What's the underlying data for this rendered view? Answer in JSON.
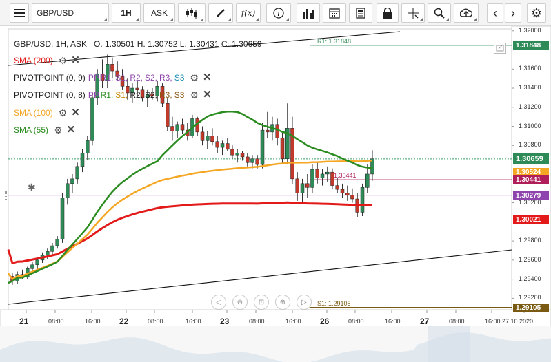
{
  "toolbar": {
    "symbol": "GBP/USD",
    "timeframe": "1H",
    "price_type": "ASK"
  },
  "legend": {
    "ohlc": "GBP/USD, 1H, ASK   O. 1.30501 H. 1.30752 L. 1.30431 C. 1.30659",
    "sma200": "SMA (200)",
    "pivot1_prefix": "PIVOTPOINT (0, 9)",
    "pivot2_prefix": "PIVOTPOINT (0, 8)",
    "pivot_parts": [
      "PP,",
      "R1,",
      "S1,",
      "R2,",
      "S2,",
      "R3,",
      "S3"
    ],
    "sma100": "SMA (100)",
    "sma55": "SMA (55)"
  },
  "colors": {
    "sma200": "#e31a1a",
    "sma100": "#f5a623",
    "sma55": "#2a8c1f",
    "up": "#2e8b57",
    "down": "#c0392b",
    "pivot": "#8e44ad"
  },
  "chart_data": {
    "type": "candlestick",
    "symbol": "GBP/USD",
    "timeframe": "1H",
    "ohlc": {
      "open": 1.30501,
      "high": 1.30752,
      "low": 1.30431,
      "close": 1.30659
    },
    "y_ticks": [
      "1.32000",
      "1.31600",
      "1.31400",
      "1.31200",
      "1.31000",
      "1.30800",
      "1.30200",
      "1.29800",
      "1.29600",
      "1.29400",
      "1.29200"
    ],
    "ylim": [
      1.2908,
      1.3202
    ],
    "x_ticks": [
      "21",
      "08:00",
      "16:00",
      "22",
      "08:00",
      "16:00",
      "23",
      "08:00",
      "16:00",
      "26",
      "08:00",
      "16:00",
      "27",
      "08:00",
      "16:00",
      "27.10.2020"
    ],
    "price_levels": [
      {
        "label": "1.31848",
        "name": "R1: 1.31848",
        "value": 1.31848,
        "color": "#2e8b57"
      },
      {
        "label": "1.30659",
        "name": "",
        "value": 1.30659,
        "color": "#2e8b57"
      },
      {
        "label": "1.30524",
        "name": "",
        "value": 1.30524,
        "color": "#f5a623"
      },
      {
        "label": "1.30441",
        "name": "1.30441",
        "value": 1.30441,
        "color": "#b01e5a"
      },
      {
        "label": "1.30279",
        "name": "",
        "value": 1.30279,
        "color": "#8e44ad"
      },
      {
        "label": "1.30021",
        "name": "",
        "value": 1.30021,
        "color": "#e31a1a"
      },
      {
        "label": "1.29105",
        "name": "S1: 1.29105",
        "value": 1.29105,
        "color": "#7a5a12"
      }
    ],
    "candles": [
      [
        1.2943,
        1.2946,
        1.2934,
        1.2938
      ],
      [
        1.2938,
        1.2948,
        1.2935,
        1.2945
      ],
      [
        1.2945,
        1.295,
        1.294,
        1.2942
      ],
      [
        1.2942,
        1.2953,
        1.294,
        1.2951
      ],
      [
        1.2951,
        1.2958,
        1.2947,
        1.2955
      ],
      [
        1.2955,
        1.2962,
        1.295,
        1.296
      ],
      [
        1.296,
        1.2968,
        1.2957,
        1.2965
      ],
      [
        1.2965,
        1.2972,
        1.2961,
        1.2969
      ],
      [
        1.2969,
        1.2978,
        1.2966,
        1.2975
      ],
      [
        1.2975,
        1.2985,
        1.2972,
        1.2982
      ],
      [
        1.2982,
        1.303,
        1.2978,
        1.3025
      ],
      [
        1.3025,
        1.3045,
        1.3018,
        1.304
      ],
      [
        1.304,
        1.305,
        1.303,
        1.3045
      ],
      [
        1.3045,
        1.3062,
        1.304,
        1.3058
      ],
      [
        1.3058,
        1.3076,
        1.3052,
        1.3072
      ],
      [
        1.3072,
        1.309,
        1.3065,
        1.3085
      ],
      [
        1.3085,
        1.3135,
        1.308,
        1.313
      ],
      [
        1.313,
        1.316,
        1.3122,
        1.3155
      ],
      [
        1.3155,
        1.317,
        1.314,
        1.3148
      ],
      [
        1.3148,
        1.3175,
        1.314,
        1.3165
      ],
      [
        1.3165,
        1.3172,
        1.315,
        1.3158
      ],
      [
        1.3158,
        1.3168,
        1.3148,
        1.3152
      ],
      [
        1.3152,
        1.316,
        1.3138,
        1.3142
      ],
      [
        1.3142,
        1.315,
        1.3128,
        1.3135
      ],
      [
        1.3135,
        1.3145,
        1.3125,
        1.314
      ],
      [
        1.314,
        1.3148,
        1.313,
        1.3138
      ],
      [
        1.3138,
        1.3142,
        1.3126,
        1.313
      ],
      [
        1.313,
        1.3138,
        1.312,
        1.3134
      ],
      [
        1.3134,
        1.314,
        1.3128,
        1.3132
      ],
      [
        1.3132,
        1.3148,
        1.3126,
        1.3142
      ],
      [
        1.3142,
        1.3145,
        1.312,
        1.3124
      ],
      [
        1.3124,
        1.313,
        1.3095,
        1.31
      ],
      [
        1.31,
        1.311,
        1.3085,
        1.3095
      ],
      [
        1.3095,
        1.3105,
        1.3088,
        1.3102
      ],
      [
        1.3102,
        1.3108,
        1.3092,
        1.3096
      ],
      [
        1.3096,
        1.3104,
        1.3085,
        1.309
      ],
      [
        1.309,
        1.3112,
        1.3088,
        1.3108
      ],
      [
        1.3108,
        1.311,
        1.309,
        1.3094
      ],
      [
        1.3094,
        1.31,
        1.308,
        1.3085
      ],
      [
        1.3085,
        1.3095,
        1.3076,
        1.309
      ],
      [
        1.309,
        1.3098,
        1.308,
        1.3084
      ],
      [
        1.3084,
        1.309,
        1.3072,
        1.3078
      ],
      [
        1.3078,
        1.3085,
        1.307,
        1.3082
      ],
      [
        1.3082,
        1.3088,
        1.3074,
        1.3076
      ],
      [
        1.3076,
        1.308,
        1.3066,
        1.307
      ],
      [
        1.307,
        1.3076,
        1.3062,
        1.3072
      ],
      [
        1.3072,
        1.3074,
        1.3064,
        1.3068
      ],
      [
        1.3068,
        1.3072,
        1.3058,
        1.3062
      ],
      [
        1.3062,
        1.307,
        1.3056,
        1.3066
      ],
      [
        1.3066,
        1.307,
        1.3056,
        1.306
      ],
      [
        1.306,
        1.3104,
        1.3056,
        1.3096
      ],
      [
        1.3096,
        1.3115,
        1.3088,
        1.3094
      ],
      [
        1.3094,
        1.311,
        1.3085,
        1.3102
      ],
      [
        1.3102,
        1.3108,
        1.308,
        1.3088
      ],
      [
        1.3088,
        1.3095,
        1.306,
        1.3066
      ],
      [
        1.3066,
        1.3124,
        1.306,
        1.3098
      ],
      [
        1.3098,
        1.311,
        1.304,
        1.3045
      ],
      [
        1.3045,
        1.3052,
        1.3022,
        1.303
      ],
      [
        1.303,
        1.3045,
        1.302,
        1.304
      ],
      [
        1.304,
        1.305,
        1.3025,
        1.3036
      ],
      [
        1.3036,
        1.306,
        1.303,
        1.3055
      ],
      [
        1.3055,
        1.3062,
        1.304,
        1.3046
      ],
      [
        1.3046,
        1.3055,
        1.3038,
        1.305
      ],
      [
        1.305,
        1.3058,
        1.3042,
        1.3052
      ],
      [
        1.3052,
        1.3056,
        1.3034,
        1.3038
      ],
      [
        1.3038,
        1.3046,
        1.303,
        1.3034
      ],
      [
        1.3034,
        1.304,
        1.3025,
        1.303
      ],
      [
        1.303,
        1.3038,
        1.3022,
        1.3028
      ],
      [
        1.3028,
        1.3035,
        1.302,
        1.3024
      ],
      [
        1.3024,
        1.303,
        1.3005,
        1.301
      ],
      [
        1.301,
        1.304,
        1.3006,
        1.3036
      ],
      [
        1.3036,
        1.306,
        1.303,
        1.305
      ],
      [
        1.305,
        1.3075,
        1.3043,
        1.3066
      ]
    ]
  },
  "nav": [
    "◁",
    "⊖",
    "⊡",
    "⊕",
    "▷"
  ]
}
